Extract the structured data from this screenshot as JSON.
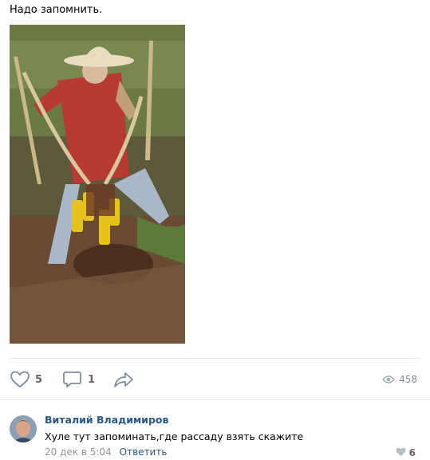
{
  "post": {
    "text": "Надо запомнить."
  },
  "actions": {
    "likes": "5",
    "comments": "1",
    "views": "458"
  },
  "comment": {
    "author": "Виталий Владимиров",
    "text": "Хуле тут запоминать,где рассаду взять скажите",
    "date": "20 дек в 5:04",
    "reply_label": "Ответить",
    "likes": "6"
  },
  "colors": {
    "link": "#2a5885",
    "muted": "#939393",
    "separator": "#e7e8ec",
    "icon": "#818c99"
  },
  "icons": [
    "heart-icon",
    "comment-icon",
    "share-icon",
    "eye-icon",
    "heart-small-icon"
  ]
}
